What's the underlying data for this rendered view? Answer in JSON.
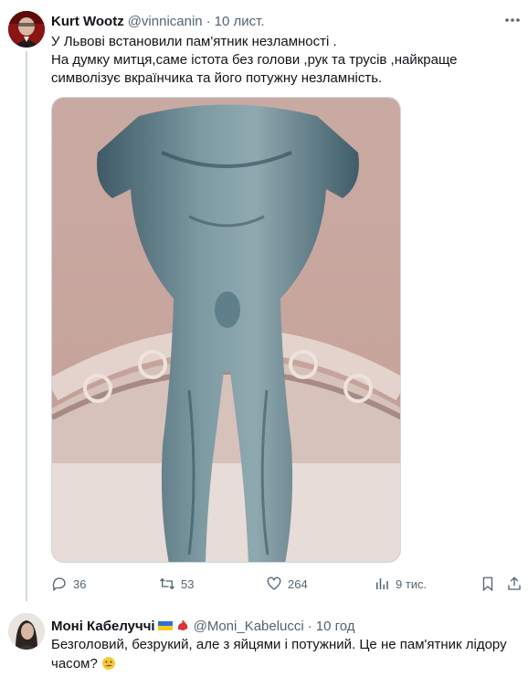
{
  "tweet": {
    "display_name": "Kurt Wootz",
    "handle": "@vinnicanin",
    "separator": "·",
    "time": "10 лист.",
    "text_line1": "У Львові встановили пам'ятник незламності .",
    "text_line2": "На думку митця,саме істота без голови ,рук та трусів ,найкраще",
    "text_line3": "символізує вкраїнчика та його потужну незламність.",
    "stats": {
      "replies": "36",
      "retweets": "53",
      "likes": "264",
      "views": "9 тис."
    }
  },
  "reply": {
    "display_name": "Моні Кабелуччі",
    "handle": "@Moni_Kabelucci",
    "separator": "·",
    "time": "10 год",
    "text_line1": "Безголовий, безрукий, але з яйцями і потужний. Це не пам'ятник лідору",
    "text_line2": "часом?"
  },
  "icons": {
    "reply": "speech-bubble-icon",
    "retweet": "retweet-icon",
    "like": "heart-icon",
    "views": "bar-chart-icon",
    "bookmark": "bookmark-icon",
    "share": "share-icon",
    "more": "more-dots-icon"
  },
  "colors": {
    "text": "#0f1419",
    "secondary": "#536471",
    "divider": "#cfd9de"
  }
}
